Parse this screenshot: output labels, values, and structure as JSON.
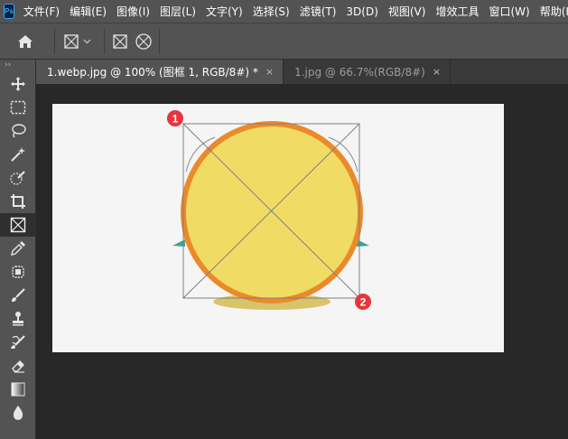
{
  "app": {
    "logo": "Ps"
  },
  "menu": [
    "文件(F)",
    "编辑(E)",
    "图像(I)",
    "图层(L)",
    "文字(Y)",
    "选择(S)",
    "滤镜(T)",
    "3D(D)",
    "视图(V)",
    "增效工具",
    "窗口(W)",
    "帮助(H)"
  ],
  "options_bar": {
    "home_icon": "home-icon",
    "frame_tool_icon": "rectangle-frame-icon",
    "frame_rect_icon": "rectangle-frame-icon",
    "frame_ellipse_icon": "ellipse-frame-icon"
  },
  "toolbar": {
    "grip": "››",
    "tools": [
      "move-icon",
      "marquee-icon",
      "lasso-icon",
      "magic-wand-icon",
      "quick-selection-icon",
      "crop-icon",
      "frame-icon",
      "eyedropper-icon",
      "healing-brush-icon",
      "brush-icon",
      "clone-stamp-icon",
      "history-brush-icon",
      "eraser-icon",
      "gradient-icon",
      "blur-icon"
    ],
    "active_tool": "frame-icon"
  },
  "tabs": [
    {
      "label": "1.webp.jpg @ 100% (图框 1, RGB/8#) *",
      "close": "×",
      "active": true
    },
    {
      "label": "1.jpg @ 66.7%(RGB/8#)",
      "close": "×",
      "active": false
    }
  ],
  "annotations": [
    "1",
    "2"
  ],
  "colors": {
    "sun_fill": "#f0dc64",
    "sun_ring": "#eb8a2a",
    "shadow": "#d9c46a",
    "wing": "#3aa394",
    "badge": "#e8343c",
    "canvas": "#f5f5f5"
  }
}
